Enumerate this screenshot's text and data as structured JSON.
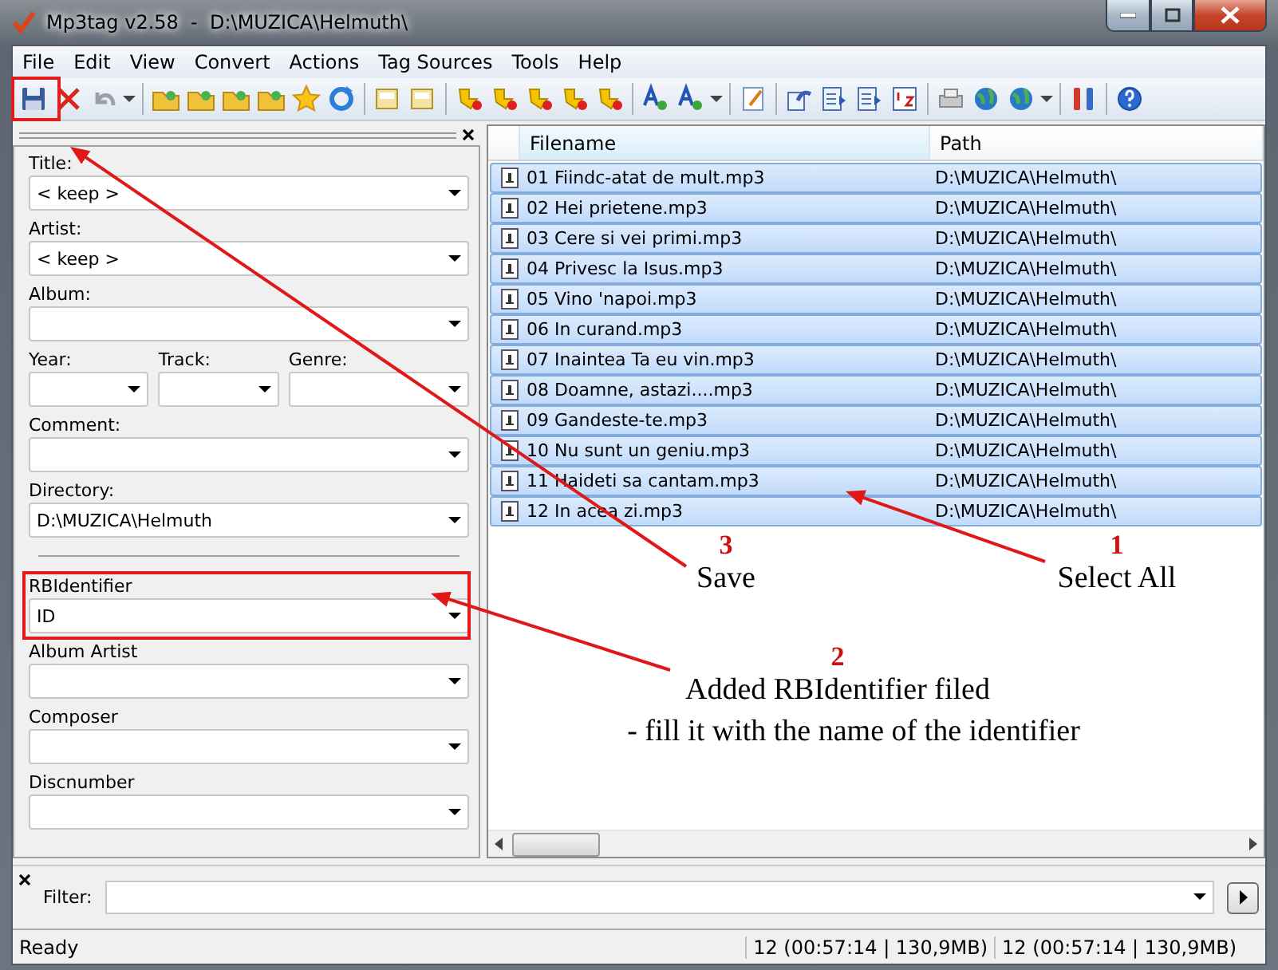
{
  "window": {
    "title": "Mp3tag v2.58  -  D:\\MUZICA\\Helmuth\\"
  },
  "menu": [
    "File",
    "Edit",
    "View",
    "Convert",
    "Actions",
    "Tag Sources",
    "Tools",
    "Help"
  ],
  "tag_panel": {
    "fields": [
      {
        "kind": "combo",
        "label": "Title:",
        "value": "< keep >"
      },
      {
        "kind": "combo",
        "label": "Artist:",
        "value": "< keep >"
      },
      {
        "kind": "combo",
        "label": "Album:"
      },
      {
        "kind": "triple",
        "fields": [
          {
            "label": "Year:"
          },
          {
            "label": "Track:"
          },
          {
            "label": "Genre:"
          }
        ]
      },
      {
        "kind": "combo",
        "label": "Comment:"
      },
      {
        "kind": "combo",
        "label": "Directory:",
        "value": "D:\\MUZICA\\Helmuth"
      },
      {
        "kind": "separator"
      },
      {
        "kind": "combo",
        "label": "RBIdentifier",
        "value": "ID"
      },
      {
        "kind": "combo",
        "label": "Album Artist"
      },
      {
        "kind": "combo",
        "label": "Composer"
      },
      {
        "kind": "combo",
        "label": "Discnumber"
      }
    ]
  },
  "file_list": {
    "columns": [
      "Filename",
      "Path"
    ],
    "rows": [
      {
        "filename": "01 Fiindc-atat de mult.mp3",
        "path": "D:\\MUZICA\\Helmuth\\",
        "selected": true
      },
      {
        "filename": "02 Hei prietene.mp3",
        "path": "D:\\MUZICA\\Helmuth\\",
        "selected": true
      },
      {
        "filename": "03 Cere si vei primi.mp3",
        "path": "D:\\MUZICA\\Helmuth\\",
        "selected": true
      },
      {
        "filename": "04 Privesc la Isus.mp3",
        "path": "D:\\MUZICA\\Helmuth\\",
        "selected": true
      },
      {
        "filename": "05 Vino 'napoi.mp3",
        "path": "D:\\MUZICA\\Helmuth\\",
        "selected": true
      },
      {
        "filename": "06 In curand.mp3",
        "path": "D:\\MUZICA\\Helmuth\\",
        "selected": true
      },
      {
        "filename": "07 Inaintea Ta eu vin.mp3",
        "path": "D:\\MUZICA\\Helmuth\\",
        "selected": true
      },
      {
        "filename": "08 Doamne, astazi....mp3",
        "path": "D:\\MUZICA\\Helmuth\\",
        "selected": true
      },
      {
        "filename": "09 Gandeste-te.mp3",
        "path": "D:\\MUZICA\\Helmuth\\",
        "selected": true
      },
      {
        "filename": "10 Nu sunt un geniu.mp3",
        "path": "D:\\MUZICA\\Helmuth\\",
        "selected": true
      },
      {
        "filename": "11 Haideti sa cantam.mp3",
        "path": "D:\\MUZICA\\Helmuth\\",
        "selected": true
      },
      {
        "filename": "12 In acea zi.mp3",
        "path": "D:\\MUZICA\\Helmuth\\",
        "selected": true
      }
    ]
  },
  "filter": {
    "label": "Filter:"
  },
  "status_bar": [
    "Ready",
    "12 (00:57:14 | 130,9MB)",
    "12 (00:57:14 | 130,9MB)"
  ],
  "annotations": [
    {
      "number": "3",
      "lines": [
        "Save"
      ]
    },
    {
      "number": "1",
      "lines": [
        "Select All"
      ]
    },
    {
      "number": "2",
      "lines": [
        "Added RBIdentifier filed",
        "- fill it with the name of the identifier"
      ]
    }
  ]
}
